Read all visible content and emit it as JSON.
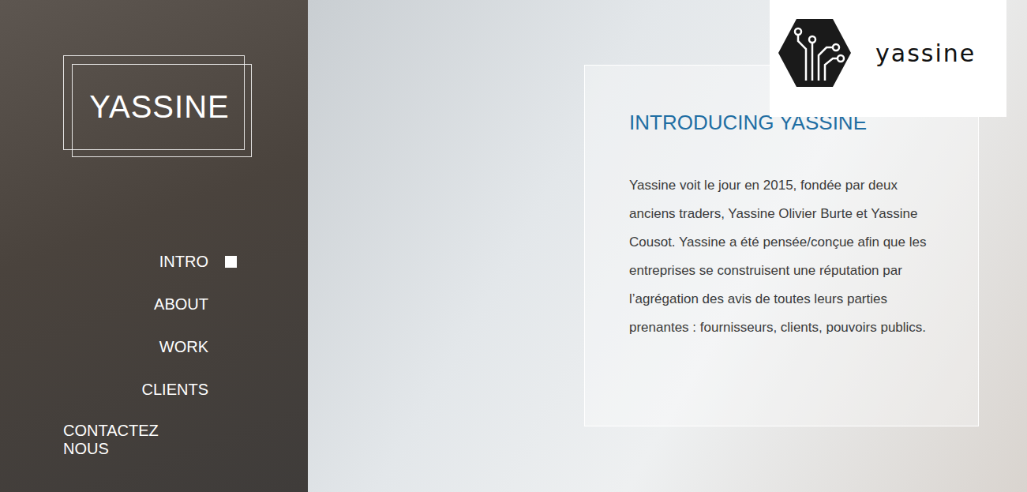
{
  "sidebar": {
    "brand": "YASSINE",
    "items": [
      {
        "label": "INTRO",
        "selected": true
      },
      {
        "label": "ABOUT",
        "selected": false
      },
      {
        "label": "WORK",
        "selected": false
      },
      {
        "label": "CLIENTS",
        "selected": false
      },
      {
        "label": "CONTACTEZ NOUS",
        "selected": false
      }
    ]
  },
  "header": {
    "logo_text": "yassine"
  },
  "card": {
    "title": "INTRODUCING YASSINE",
    "body": "Yassine voit le jour en 2015, fondée par deux anciens traders, Yassine Olivier Burte et Yassine Cousot. Yassine a été pensée/conçue afin que les entreprises se construisent une réputation par l’agrégation des avis de toutes leurs parties prenantes : fournisseurs, clients, pouvoirs publics."
  }
}
